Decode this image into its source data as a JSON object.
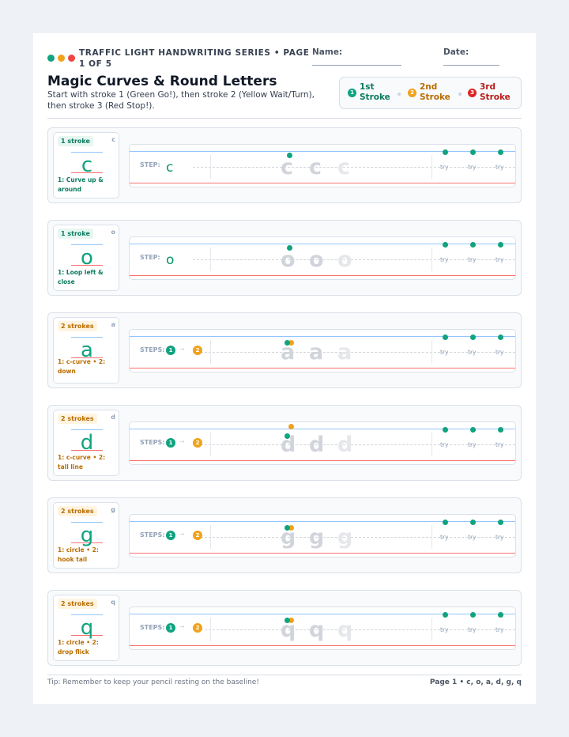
{
  "header": {
    "series": "TRAFFIC LIGHT HANDWRITING SERIES • PAGE 1 OF 5",
    "name_label": "Name:",
    "date_label": "Date:",
    "title": "Magic Curves & Round Letters",
    "subtitle": "Start with stroke 1 (Green Go!), then stroke 2 (Yellow Wait/Turn), then stroke 3 (Red Stop!)."
  },
  "colors": {
    "green": "#10a37f",
    "yellow": "#f0a21a",
    "red": "#dc2626"
  },
  "legend": [
    {
      "num": "1",
      "label": "1st Stroke",
      "color": "#10a37f"
    },
    {
      "num": "2",
      "label": "2nd Stroke",
      "color": "#f0a21a"
    },
    {
      "num": "3",
      "label": "3rd Stroke",
      "color": "#dc2626"
    }
  ],
  "rows": [
    {
      "letter": "c",
      "strokes_label": "1 stroke",
      "caption": "1: Curve up & around",
      "steps_label": "STEP:",
      "multi": false,
      "try_label": "try"
    },
    {
      "letter": "o",
      "strokes_label": "1 stroke",
      "caption": "1: Loop left & close",
      "steps_label": "STEP:",
      "multi": false,
      "try_label": "try"
    },
    {
      "letter": "a",
      "strokes_label": "2 strokes",
      "caption": "1: c-curve • 2: down",
      "steps_label": "STEPS:",
      "multi": true,
      "try_label": "try"
    },
    {
      "letter": "d",
      "strokes_label": "2 strokes",
      "caption": "1: c-curve • 2: tall line",
      "steps_label": "STEPS:",
      "multi": true,
      "try_label": "try"
    },
    {
      "letter": "g",
      "strokes_label": "2 strokes",
      "caption": "1: circle • 2: hook tail",
      "steps_label": "STEPS:",
      "multi": true,
      "try_label": "try"
    },
    {
      "letter": "q",
      "strokes_label": "2 strokes",
      "caption": "1: circle • 2: drop flick",
      "steps_label": "STEPS:",
      "multi": true,
      "try_label": "try"
    }
  ],
  "footer": {
    "tip": "Tip: Remember to keep your pencil resting on the baseline!",
    "page": "Page 1 • c, o, a, d, g, q"
  }
}
